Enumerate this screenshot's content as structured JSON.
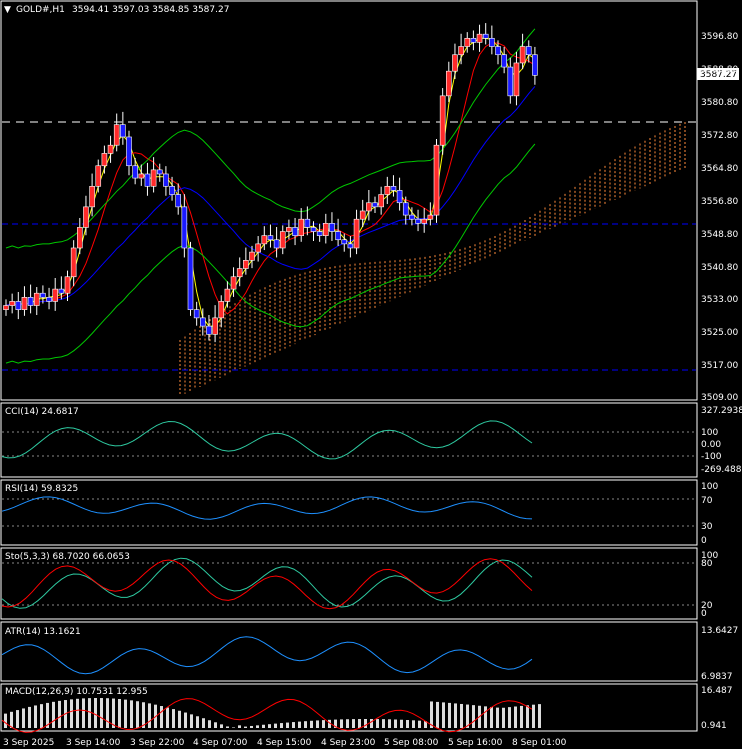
{
  "header": {
    "symbol_tf": "GOLD#,H1",
    "ohlc": "3594.41 3597.03 3584.85 3587.27"
  },
  "price_marker": "3587.27",
  "colors": {
    "bg": "#000000",
    "frame": "#ffffff",
    "bull": "#ffffff",
    "bear_body": "#1a1aff",
    "bull_body": "#ff2a2a",
    "bb": "#00c800",
    "ma_fast": "#ffff00",
    "ma_mid": "#ff0000",
    "ma_slow": "#0000ff",
    "cloud": "#ff8c3c",
    "indicator": "#1e90ff",
    "signal": "#ff0000",
    "level_line": "#0000ff",
    "dash_line": "#ffffff"
  },
  "main": {
    "price_ticks": [
      "3596.80",
      "3588.80",
      "3580.80",
      "3572.80",
      "3564.80",
      "3556.80",
      "3548.80",
      "3540.80",
      "3533.00",
      "3525.00",
      "3517.00",
      "3509.00"
    ]
  },
  "cci": {
    "label": "CCI(14) 24.6817",
    "ticks": [
      "327.2938",
      "100",
      "0.00",
      "-100",
      "-269.4882"
    ]
  },
  "rsi": {
    "label": "RSI(14) 59.8325",
    "ticks": [
      "100",
      "70",
      "30",
      "0"
    ]
  },
  "sto": {
    "label": "Sto(5,3,3) 68.7020 66.0653",
    "ticks": [
      "100",
      "80",
      "20",
      "0"
    ]
  },
  "atr": {
    "label": "ATR(14) 13.1621",
    "ticks": [
      "13.6427",
      "6.9837"
    ]
  },
  "macd": {
    "label": "MACD(12,26,9) 10.7531 12.955",
    "ticks": [
      "16.487",
      "0.941"
    ]
  },
  "time_axis": [
    "3 Sep 2025",
    "3 Sep 14:00",
    "3 Sep 22:00",
    "4 Sep 07:00",
    "4 Sep 15:00",
    "4 Sep 23:00",
    "5 Sep 08:00",
    "5 Sep 16:00",
    "8 Sep 01:00"
  ]
}
